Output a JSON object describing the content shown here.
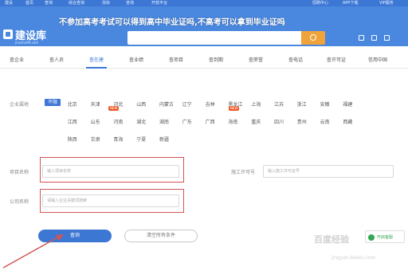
{
  "overlay_title": "不参加高考考试可以得到高中毕业证吗,不高考可以拿到毕业证吗",
  "utilbar": {
    "items": [
      "建设",
      "首页",
      "查询",
      "综合查询",
      "找标",
      "咨询",
      "开放平台"
    ],
    "right_items": [
      "招聘中心",
      "APP下载",
      "VIP服务"
    ]
  },
  "header": {
    "logo_text": "建设库",
    "logo_sub": "jianshe99.com",
    "search_placeholder": ""
  },
  "nav": {
    "items": [
      {
        "label": "查企业",
        "active": false,
        "hot": false
      },
      {
        "label": "查人员",
        "active": false,
        "hot": false
      },
      {
        "label": "查在建",
        "active": true,
        "hot": true
      },
      {
        "label": "查业绩",
        "active": false,
        "hot": false
      },
      {
        "label": "查项目",
        "active": false,
        "hot": false
      },
      {
        "label": "查到期",
        "active": false,
        "hot": true
      },
      {
        "label": "查荣誉",
        "active": false,
        "hot": false
      },
      {
        "label": "查电话",
        "active": false,
        "hot": false
      },
      {
        "label": "查许可证",
        "active": false,
        "hot": false
      },
      {
        "label": "信用中国",
        "active": false,
        "hot": false
      }
    ],
    "hot_label": "NEW"
  },
  "filter": {
    "region_label": "企业属地",
    "regions": [
      "不限",
      "北京",
      "天津",
      "河北",
      "山西",
      "内蒙古",
      "辽宁",
      "吉林",
      "黑龙江",
      "上海",
      "江苏",
      "浙江",
      "安徽",
      "福建",
      "江西",
      "山东",
      "河南",
      "湖北",
      "湖南",
      "广东",
      "广西",
      "海南",
      "重庆",
      "四川",
      "贵州",
      "云南",
      "西藏",
      "陕西",
      "甘肃",
      "青海",
      "宁夏",
      "新疆"
    ],
    "selected_region": "不限"
  },
  "form": {
    "project_name_label": "项目名称",
    "project_name_placeholder": "输入项目名称",
    "permit_label": "施工许可号",
    "permit_placeholder": "输入施工许可证号",
    "company_label": "公司名称",
    "company_placeholder": "请输入企业关键词搜索"
  },
  "buttons": {
    "query": "查询",
    "reset": "清空所有条件"
  },
  "widget": {
    "label": "开启客服"
  },
  "watermark": "百度经验",
  "watermark_sub": "jingyan.baidu.com"
}
